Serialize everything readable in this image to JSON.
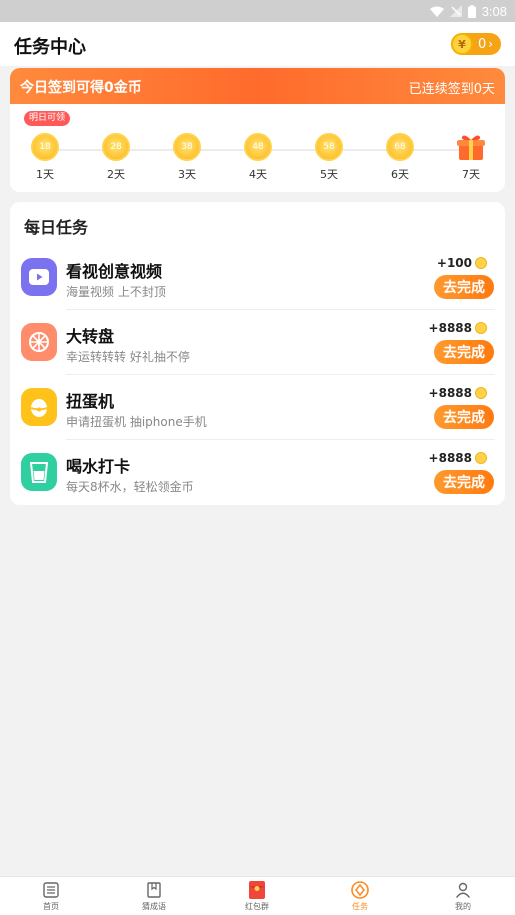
{
  "status_bar": {
    "time": "3:08"
  },
  "header": {
    "title": "任务中心",
    "coin_balance": "0",
    "coin_symbol": "¥",
    "chevron": "›"
  },
  "signin": {
    "headline": "今日签到可得0金币",
    "streak": "已连续签到0天",
    "tomorrow_tag": "明日可领",
    "days": [
      {
        "coins": "18",
        "label": "1天"
      },
      {
        "coins": "28",
        "label": "2天"
      },
      {
        "coins": "38",
        "label": "3天"
      },
      {
        "coins": "48",
        "label": "4天"
      },
      {
        "coins": "58",
        "label": "5天"
      },
      {
        "coins": "68",
        "label": "6天"
      },
      {
        "coins": "",
        "label": "7天",
        "icon": "gift-icon"
      }
    ]
  },
  "daily_tasks": {
    "title": "每日任务",
    "items": [
      {
        "name": "看视创意视频",
        "desc": "海量视频 上不封顶",
        "reward": "+100",
        "button": "去完成",
        "icon": "video-play-icon",
        "color": "#7b72f0"
      },
      {
        "name": "大转盘",
        "desc": "幸运转转转 好礼抽不停",
        "reward": "+8888",
        "button": "去完成",
        "icon": "wheel-icon",
        "color": "#ff8c6b"
      },
      {
        "name": "扭蛋机",
        "desc": "申请扭蛋机 抽iphone手机",
        "reward": "+8888",
        "button": "去完成",
        "icon": "capsule-egg-icon",
        "color": "#ffc21a"
      },
      {
        "name": "喝水打卡",
        "desc": "每天8杯水，轻松领金币",
        "reward": "+8888",
        "button": "去完成",
        "icon": "water-cup-icon",
        "color": "#2fcfa0"
      }
    ]
  },
  "tabbar": {
    "tabs": [
      {
        "label": "首页",
        "icon": "list-icon",
        "active": false
      },
      {
        "label": "猜成语",
        "icon": "book-icon",
        "active": false
      },
      {
        "label": "红包群",
        "icon": "red-packet-icon",
        "active": false
      },
      {
        "label": "任务",
        "icon": "task-diamond-icon",
        "active": true
      },
      {
        "label": "我的",
        "icon": "user-icon",
        "active": false
      }
    ]
  },
  "colors": {
    "accent": "#ff7a10",
    "banner": "#ff6b2c",
    "coin": "#ffc83a"
  }
}
